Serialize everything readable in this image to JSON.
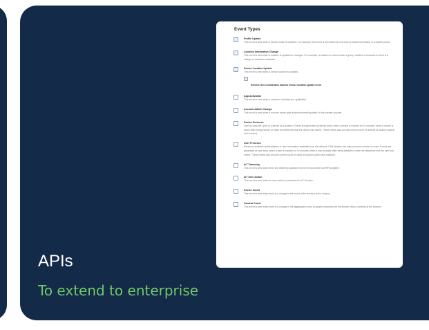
{
  "slide": {
    "title": "APIs",
    "subtitle": "To extend to enterprise",
    "colors": {
      "background": "#132a49",
      "accent_text": "#72c867",
      "title_text": "#ffffff"
    }
  },
  "panel": {
    "heading": "Event Types",
    "events": [
      {
        "name": "Profile Update",
        "description": "This event is sent when a device profile is updated. For example, this event is sent when an end-user provides information in a captive portal.",
        "checked": true
      },
      {
        "name": "Location Information Change",
        "description": "This event is sent when a location is updated or changed. For example, a location is moved under a group, location is renamed or there is a change to location's metadata.",
        "checked": true
      },
      {
        "name": "Device Location Update",
        "description": "This event is sent when a device location is updated.",
        "checked": true,
        "sub_option": {
          "label": "Receive Geo Coordinates data for Device location update event",
          "checked": true
        }
      },
      {
        "name": "App Activation",
        "description": "This event is sent when a customer activates the application.",
        "checked": false
      },
      {
        "name": "Account Admin Change",
        "description": "This event is sent when a account admin gets added/removed/updated for the partner account.",
        "checked": false
      },
      {
        "name": "Device Presence",
        "description": "Used to track life cycle of a device at a location. Events are generated at device entry, when a device is inactive for 10 minutes, when a device is active after being inactive or when we determine that the device has exited. These events also provide current count of devices at location (active and inactive).",
        "checked": false
      },
      {
        "name": "User Presence",
        "description": "Based on available authentication or user information available from the network, DNA Spaces can map presence events to a user. Events are generated at user entry, when a user is inactive for 10 minutes, when a user is active after being inactive or when we determine that the user has exited. These events also provide current count of users at location (active and inactive).",
        "checked": false
      },
      {
        "name": "IoT Telemetry",
        "description": "This event is sent when there are telemetry updates from IoT Devices like BLE/RFID/Zigbee.",
        "checked": false
      },
      {
        "name": "IoT User Action",
        "description": "This event is sent when an user action is performed in IoT Devices.",
        "checked": false
      },
      {
        "name": "Device Count",
        "description": "This event is sent when there is a change in the count of the devices at the location.",
        "checked": false
      },
      {
        "name": "Camera Count",
        "description": "This event is sent when there is a change in the aggregated count of people computed via the Meraki Vision Cameras at the location.",
        "checked": false
      }
    ]
  }
}
